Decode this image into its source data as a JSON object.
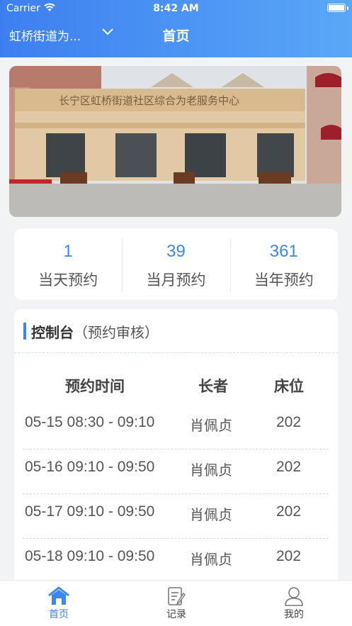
{
  "status_bar": {
    "carrier": "Carrier",
    "time": "8:42 AM"
  },
  "header": {
    "location": "虹桥街道为...",
    "title": "首页"
  },
  "banner": {
    "sign_text": "长宁区虹桥街道社区综合为老服务中心"
  },
  "stats": [
    {
      "value": "1",
      "label": "当天预约"
    },
    {
      "value": "39",
      "label": "当月预约"
    },
    {
      "value": "361",
      "label": "当年预约"
    }
  ],
  "console": {
    "title": "控制台",
    "subtitle": "（预约审核）",
    "columns": [
      "预约时间",
      "长者",
      "床位"
    ],
    "rows": [
      {
        "time": "05-15 08:30 - 09:10",
        "elder": "肖佩贞",
        "bed": "202"
      },
      {
        "time": "05-16 09:10 - 09:50",
        "elder": "肖佩贞",
        "bed": "202"
      },
      {
        "time": "05-17 09:10 - 09:50",
        "elder": "肖佩贞",
        "bed": "202"
      },
      {
        "time": "05-18 09:10 - 09:50",
        "elder": "肖佩贞",
        "bed": "202"
      }
    ]
  },
  "tabs": [
    {
      "label": "首页",
      "icon": "home-icon",
      "active": true
    },
    {
      "label": "记录",
      "icon": "record-icon",
      "active": false
    },
    {
      "label": "我的",
      "icon": "profile-icon",
      "active": false
    }
  ],
  "colors": {
    "primary": "#3b86f0",
    "header_start": "#3d7ff0",
    "header_end": "#5aa7f7"
  }
}
